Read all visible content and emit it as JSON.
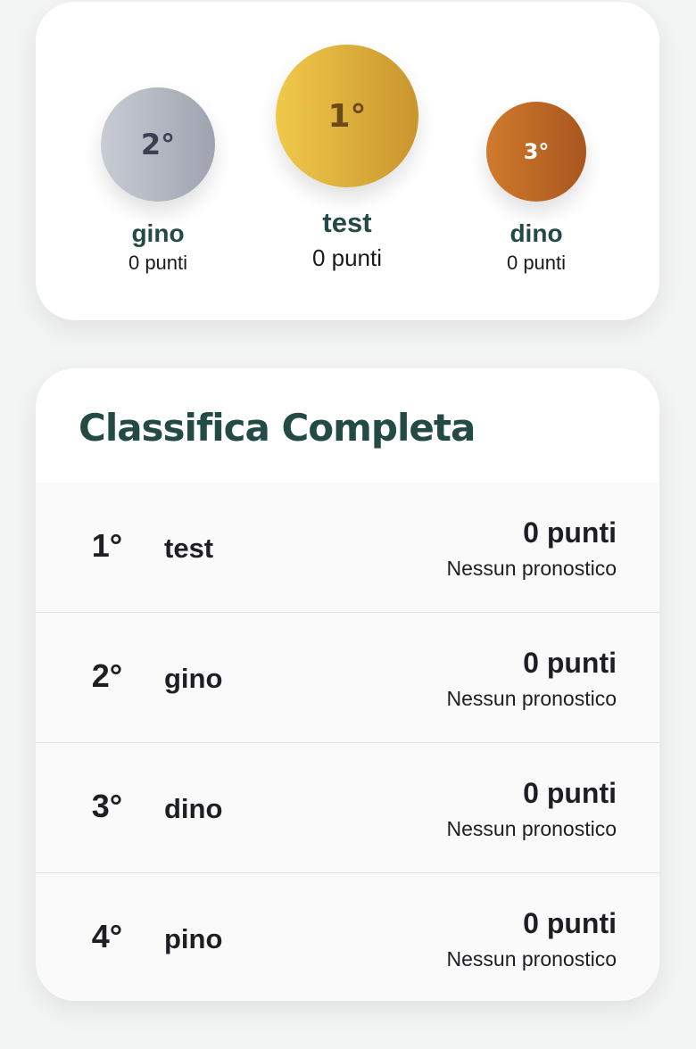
{
  "podium": {
    "first": {
      "rank": "1°",
      "name": "test",
      "points": "0 punti"
    },
    "second": {
      "rank": "2°",
      "name": "gino",
      "points": "0 punti"
    },
    "third": {
      "rank": "3°",
      "name": "dino",
      "points": "0 punti"
    }
  },
  "leaderboard": {
    "title": "Classifica Completa",
    "rows": [
      {
        "rank": "1°",
        "name": "test",
        "points": "0 punti",
        "note": "Nessun pronostico"
      },
      {
        "rank": "2°",
        "name": "gino",
        "points": "0 punti",
        "note": "Nessun pronostico"
      },
      {
        "rank": "3°",
        "name": "dino",
        "points": "0 punti",
        "note": "Nessun pronostico"
      },
      {
        "rank": "4°",
        "name": "pino",
        "points": "0 punti",
        "note": "Nessun pronostico"
      }
    ]
  },
  "colors": {
    "accent": "#234a44",
    "gold": "#e0b23c",
    "silver": "#b4b8c2",
    "bronze": "#c06a26"
  }
}
